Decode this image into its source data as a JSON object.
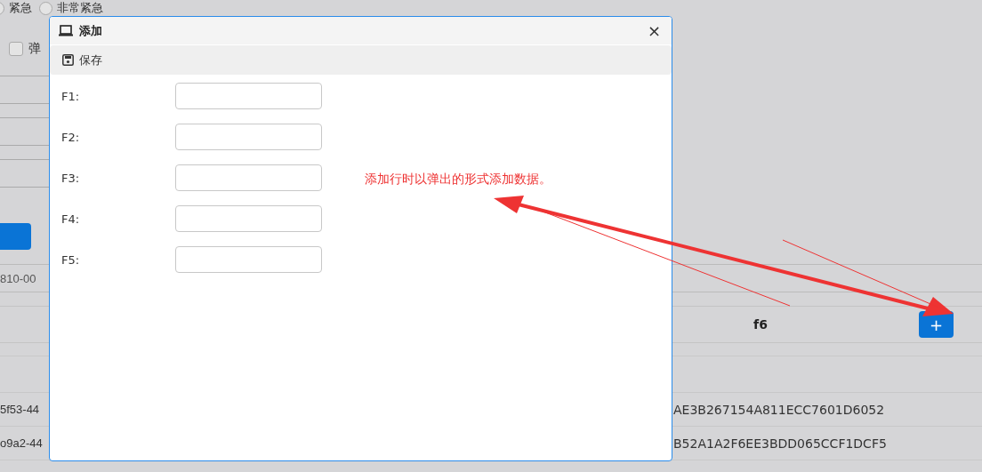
{
  "page": {
    "radios": [
      {
        "label": "紧急",
        "selected": false
      },
      {
        "label": "非常紧急",
        "selected": false
      }
    ],
    "checkbox": {
      "label": "弹",
      "checked": false
    },
    "field_fragment": "810-00",
    "table": {
      "columns": [
        "",
        "f6"
      ],
      "add_button": "+",
      "rows": [
        {
          "cells": [
            "5f53-44",
            "AE3B267154A811ECC7601D6052"
          ]
        },
        {
          "cells": [
            "o9a2-44",
            "B52A1A2F6EE3BDD065CCF1DCF5"
          ]
        }
      ]
    }
  },
  "dialog": {
    "title": "添加",
    "close": "×",
    "toolbar": {
      "save": "保存"
    },
    "fields": [
      {
        "label": "F1:"
      },
      {
        "label": "F2:"
      },
      {
        "label": "F3:"
      },
      {
        "label": "F4:"
      },
      {
        "label": "F5:"
      }
    ]
  },
  "annotation": {
    "text": "添加行时以弹出的形式添加数据。"
  }
}
